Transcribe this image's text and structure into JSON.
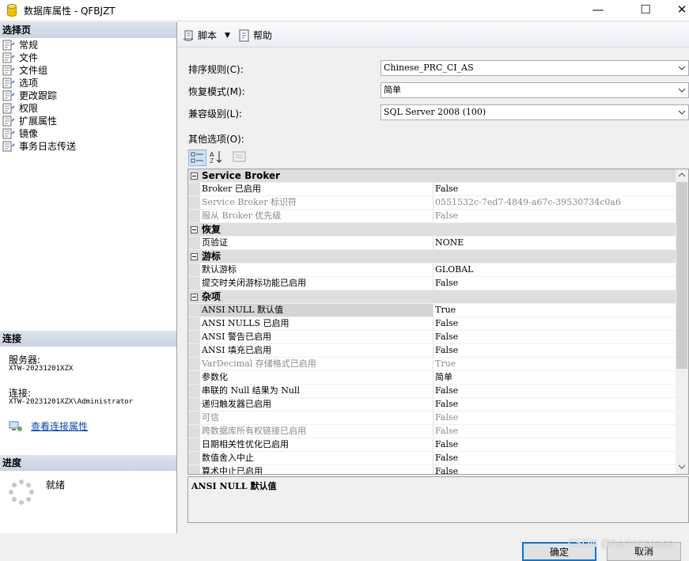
{
  "window": {
    "title": "数据库属性 - QFBJZT",
    "minimize": "—",
    "maximize": "☐",
    "close": "✕"
  },
  "left": {
    "select_page_header": "选择页",
    "nav_items": [
      "常规",
      "文件",
      "文件组",
      "选项",
      "更改跟踪",
      "权限",
      "扩展属性",
      "镜像",
      "事务日志传送"
    ],
    "connection_header": "连接",
    "server_label": "服务器:",
    "server_value": "XTW-20231201XZX",
    "connection_label": "连接:",
    "connection_value": "XTW-20231201XZX\\Administrator",
    "view_connection_link": "查看连接属性",
    "progress_header": "进度",
    "progress_status": "就绪"
  },
  "toolbar": {
    "script_label": "脚本",
    "help_label": "帮助"
  },
  "form": {
    "collation_label": "排序规则(C):",
    "collation_value": "Chinese_PRC_CI_AS",
    "recovery_label": "恢复模式(M):",
    "recovery_value": "简单",
    "compat_label": "兼容级别(L):",
    "compat_value": "SQL Server 2008 (100)",
    "other_options_label": "其他选项(O):"
  },
  "grid": {
    "rows": [
      {
        "type": "cat",
        "name": "Service Broker",
        "value": ""
      },
      {
        "type": "prop",
        "name": "Broker 已启用",
        "value": "False",
        "disabled": false
      },
      {
        "type": "prop",
        "name": "Service Broker 标识符",
        "value": "0551532c-7ed7-4849-a67c-39530734c0a6",
        "disabled": true
      },
      {
        "type": "prop",
        "name": "服从 Broker 优先级",
        "value": "False",
        "disabled": true
      },
      {
        "type": "cat",
        "name": "恢复",
        "value": ""
      },
      {
        "type": "prop",
        "name": "页验证",
        "value": "NONE",
        "disabled": false
      },
      {
        "type": "cat",
        "name": "游标",
        "value": ""
      },
      {
        "type": "prop",
        "name": "默认游标",
        "value": "GLOBAL",
        "disabled": false
      },
      {
        "type": "prop",
        "name": "提交时关闭游标功能已启用",
        "value": "False",
        "disabled": false
      },
      {
        "type": "cat",
        "name": "杂项",
        "value": ""
      },
      {
        "type": "prop",
        "name": "ANSI NULL 默认值",
        "value": "True",
        "disabled": false,
        "selected": true
      },
      {
        "type": "prop",
        "name": "ANSI NULLS 已启用",
        "value": "False",
        "disabled": false
      },
      {
        "type": "prop",
        "name": "ANSI 警告已启用",
        "value": "False",
        "disabled": false
      },
      {
        "type": "prop",
        "name": "ANSI 填充已启用",
        "value": "False",
        "disabled": false
      },
      {
        "type": "prop",
        "name": "VarDecimal 存储格式已启用",
        "value": "True",
        "disabled": true
      },
      {
        "type": "prop",
        "name": "参数化",
        "value": "简单",
        "disabled": false
      },
      {
        "type": "prop",
        "name": "串联的 Null 结果为 Null",
        "value": "False",
        "disabled": false
      },
      {
        "type": "prop",
        "name": "递归触发器已启用",
        "value": "False",
        "disabled": false
      },
      {
        "type": "prop",
        "name": "可信",
        "value": "False",
        "disabled": true
      },
      {
        "type": "prop",
        "name": "跨数据库所有权链接已启用",
        "value": "False",
        "disabled": true
      },
      {
        "type": "prop",
        "name": "日期相关性优化已启用",
        "value": "False",
        "disabled": false
      },
      {
        "type": "prop",
        "name": "数值舍入中止",
        "value": "False",
        "disabled": false
      },
      {
        "type": "prop",
        "name": "算术中止已启用",
        "value": "False",
        "disabled": false
      }
    ]
  },
  "description": "ANSI NULL 默认值",
  "buttons": {
    "ok": "确定",
    "cancel": "取消"
  },
  "watermark": "CSDN @herlngspace",
  "colors": {
    "accent": "#0078d7",
    "link": "#0645ad",
    "category_bg": "#dedede",
    "header_bg": "#c9d3e0"
  }
}
